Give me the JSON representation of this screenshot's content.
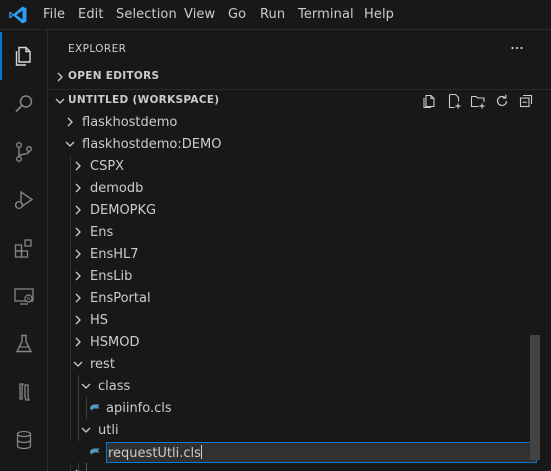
{
  "menubar": {
    "logo_icon": "vscode-logo-icon",
    "items": [
      "File",
      "Edit",
      "Selection",
      "View",
      "Go",
      "Run",
      "Terminal",
      "Help"
    ]
  },
  "activitybar": {
    "items": [
      "explorer-icon",
      "search-icon",
      "source-control-icon",
      "run-debug-icon",
      "extensions-icon",
      "remote-explorer-icon",
      "testing-icon",
      "intersystems-objectscript-icon",
      "database-icon"
    ],
    "active": "explorer-icon"
  },
  "sidebar": {
    "title": "EXPLORER",
    "more_icon": "ellipsis-icon",
    "open_editors_label": "OPEN EDITORS",
    "workspace_label": "UNTITLED (WORKSPACE)",
    "workspace_actions": [
      "new-file-icon",
      "new-file-icon",
      "new-folder-icon",
      "refresh-icon",
      "collapse-all-icon"
    ]
  },
  "tree": {
    "rows": [
      {
        "label": "flaskhostdemo",
        "expanded": false
      },
      {
        "label": "flaskhostdemo:DEMO",
        "expanded": true
      },
      {
        "label": "CSPX",
        "expanded": false
      },
      {
        "label": "demodb",
        "expanded": false
      },
      {
        "label": "DEMOPKG",
        "expanded": false
      },
      {
        "label": "Ens",
        "expanded": false
      },
      {
        "label": "EnsHL7",
        "expanded": false
      },
      {
        "label": "EnsLib",
        "expanded": false
      },
      {
        "label": "EnsPortal",
        "expanded": false
      },
      {
        "label": "HS",
        "expanded": false
      },
      {
        "label": "HSMOD",
        "expanded": false
      },
      {
        "label": "rest",
        "expanded": true
      },
      {
        "label": "class",
        "expanded": true
      },
      {
        "label": "apiinfo.cls",
        "file": true
      },
      {
        "label": "utli",
        "expanded": true
      },
      {
        "label": "requestUtli.cls",
        "file": true,
        "renaming": true
      }
    ]
  },
  "colors": {
    "background": "#181818",
    "accent": "#0078d4",
    "text": "#cccccc",
    "cls_file_icon": "#519aba"
  }
}
